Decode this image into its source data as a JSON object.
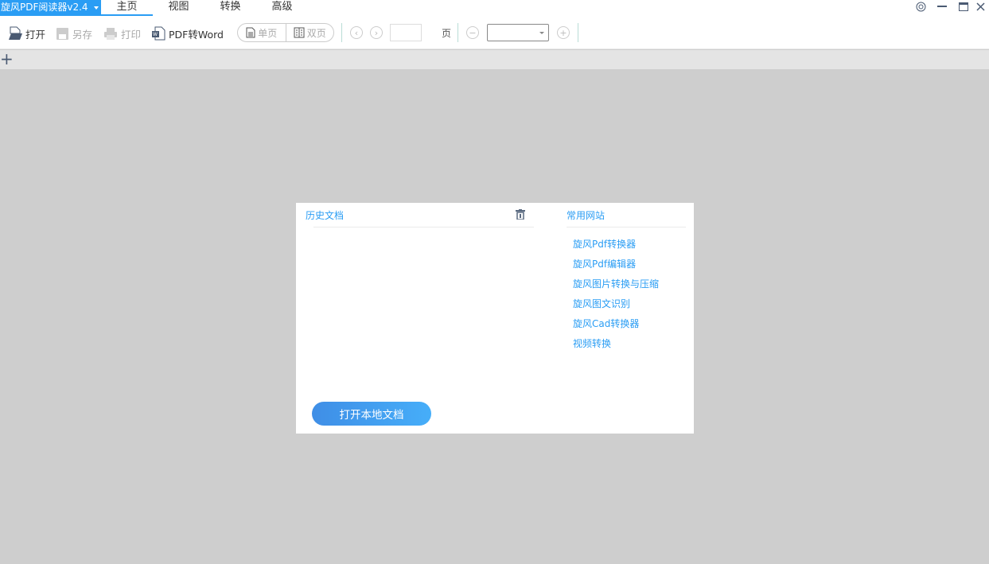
{
  "app": {
    "title": "旋风PDF阅读器v2.4"
  },
  "menu": [
    {
      "label": "主页",
      "active": true
    },
    {
      "label": "视图"
    },
    {
      "label": "转换"
    },
    {
      "label": "高级"
    }
  ],
  "toolbar": {
    "open": "打开",
    "save_as": "另存",
    "print": "打印",
    "pdf_to_word": "PDF转Word",
    "single_page": "单页",
    "double_page": "双页",
    "page_input": "",
    "page_unit": "页",
    "zoom_value": ""
  },
  "tabs": {
    "add": "+"
  },
  "history": {
    "title": "历史文档",
    "open_local": "打开本地文档"
  },
  "sites": {
    "title": "常用网站",
    "links": [
      "旋风Pdf转换器",
      "旋风Pdf编辑器",
      "旋风图片转换与压缩",
      "旋风图文识别",
      "旋风Cad转换器",
      "视频转换"
    ]
  },
  "colors": {
    "accent": "#2a9df4",
    "background": "#cecece"
  }
}
